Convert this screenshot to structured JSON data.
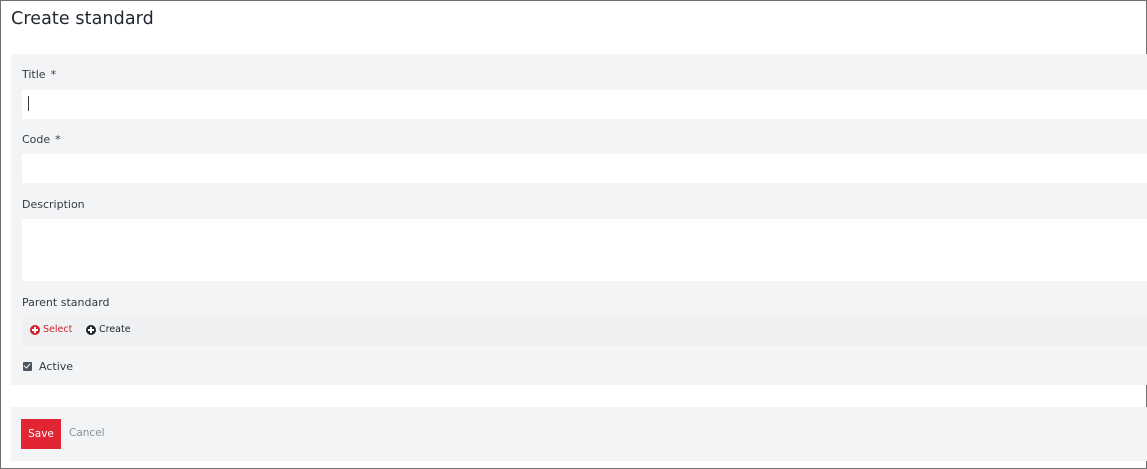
{
  "page": {
    "title": "Create standard"
  },
  "form": {
    "title_label": "Title",
    "title_required": "*",
    "title_value": "",
    "code_label": "Code",
    "code_required": "*",
    "code_value": "",
    "description_label": "Description",
    "description_value": "",
    "parent_label": "Parent standard",
    "select_label": "Select",
    "create_label": "Create",
    "active_label": "Active",
    "active_checked": true
  },
  "actions": {
    "save_label": "Save",
    "cancel_label": "Cancel"
  },
  "colors": {
    "accent": "#e12533",
    "select_link": "#d3222f",
    "panel_bg": "#f3f4f6",
    "text": "#333a42"
  },
  "icons": {
    "select": "plus-circle-icon",
    "create": "plus-circle-icon",
    "active": "checkbox-checked-icon"
  }
}
